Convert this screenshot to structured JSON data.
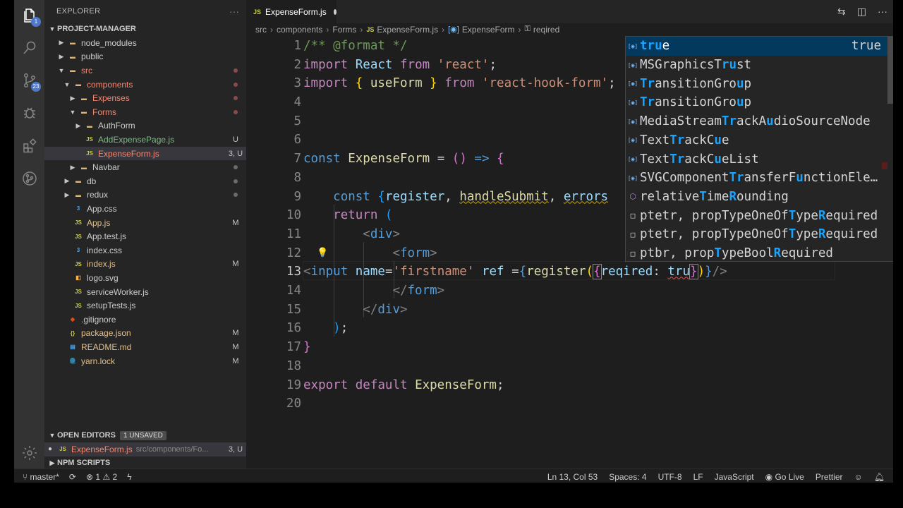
{
  "sidebar": {
    "title": "EXPLORER",
    "project": "PROJECT-MANAGER",
    "tree": [
      {
        "label": "node_modules",
        "kind": "folder",
        "depth": 1,
        "open": false,
        "deco": ""
      },
      {
        "label": "public",
        "kind": "folder",
        "depth": 1,
        "open": false,
        "deco": ""
      },
      {
        "label": "src",
        "kind": "folder",
        "depth": 1,
        "open": true,
        "deco": "dot",
        "color": "red"
      },
      {
        "label": "components",
        "kind": "folder",
        "depth": 2,
        "open": true,
        "deco": "dot",
        "color": "red"
      },
      {
        "label": "Expenses",
        "kind": "folder",
        "depth": 3,
        "open": false,
        "deco": "dot",
        "color": "red"
      },
      {
        "label": "Forms",
        "kind": "folder",
        "depth": 3,
        "open": true,
        "deco": "dot",
        "color": "red"
      },
      {
        "label": "AuthForm",
        "kind": "folder",
        "depth": 4,
        "open": false,
        "deco": ""
      },
      {
        "label": "AddExpensePage.js",
        "kind": "js",
        "depth": 4,
        "deco": "U",
        "color": "green"
      },
      {
        "label": "ExpenseForm.js",
        "kind": "js",
        "depth": 4,
        "deco": "3, U",
        "color": "red",
        "selected": true
      },
      {
        "label": "Navbar",
        "kind": "folder",
        "depth": 3,
        "open": false,
        "deco": "dot",
        "color": "gray"
      },
      {
        "label": "db",
        "kind": "folder",
        "depth": 2,
        "open": false,
        "deco": "dot",
        "color": "gray"
      },
      {
        "label": "redux",
        "kind": "folder",
        "depth": 2,
        "open": false,
        "deco": "dot",
        "color": "gray"
      },
      {
        "label": "App.css",
        "kind": "css",
        "depth": 2,
        "deco": ""
      },
      {
        "label": "App.js",
        "kind": "js",
        "depth": 2,
        "deco": "M",
        "color": "yellow"
      },
      {
        "label": "App.test.js",
        "kind": "js",
        "depth": 2,
        "deco": ""
      },
      {
        "label": "index.css",
        "kind": "css",
        "depth": 2,
        "deco": ""
      },
      {
        "label": "index.js",
        "kind": "js",
        "depth": 2,
        "deco": "M",
        "color": "yellow"
      },
      {
        "label": "logo.svg",
        "kind": "svg",
        "depth": 2,
        "deco": ""
      },
      {
        "label": "serviceWorker.js",
        "kind": "js",
        "depth": 2,
        "deco": ""
      },
      {
        "label": "setupTests.js",
        "kind": "js",
        "depth": 2,
        "deco": ""
      },
      {
        "label": ".gitignore",
        "kind": "git",
        "depth": 1,
        "deco": ""
      },
      {
        "label": "package.json",
        "kind": "json",
        "depth": 1,
        "deco": "M",
        "color": "yellow"
      },
      {
        "label": "README.md",
        "kind": "md",
        "depth": 1,
        "deco": "M",
        "color": "yellow"
      },
      {
        "label": "yarn.lock",
        "kind": "yarn",
        "depth": 1,
        "deco": "M",
        "color": "yellow"
      }
    ],
    "open_editors": {
      "title": "OPEN EDITORS",
      "badge": "1 UNSAVED",
      "file": "ExpenseForm.js",
      "path": "src/components/Fo...",
      "deco": "3, U"
    },
    "npm_scripts": "NPM SCRIPTS",
    "activity_badges": {
      "explorer": "1",
      "scm": "23"
    }
  },
  "tab": {
    "label": "ExpenseForm.js",
    "icon": "JS"
  },
  "breadcrumb": [
    "src",
    "components",
    "Forms",
    "ExpenseForm.js",
    "ExpenseForm",
    "reqired"
  ],
  "editor": {
    "line_numbers": [
      "1",
      "2",
      "3",
      "4",
      "5",
      "6",
      "7",
      "8",
      "9",
      "10",
      "11",
      "12",
      "13",
      "14",
      "15",
      "16",
      "17",
      "18",
      "19",
      "20"
    ],
    "lines": {
      "l1": "/** @format */",
      "l2_kw": "import",
      "l2_var": "React",
      "l2_from": "from",
      "l2_str": "'react'",
      "l3_kw": "import",
      "l3_fn": "useForm",
      "l3_from": "from",
      "l3_str": "'react-hook-form'",
      "l7_kw": "const",
      "l7_fn": "ExpenseForm",
      "l9_kw": "const",
      "l9_reg": "register",
      "l9_hs": "handleSubmit",
      "l9_err": "errors",
      "l10_kw": "return",
      "l11_tag": "div",
      "l12_tag": "form",
      "l13_tag": "input",
      "l13_attr1": "name",
      "l13_str": "'firstname'",
      "l13_attr2": "ref",
      "l13_fn": "register",
      "l13_key": "reqired",
      "l13_val": "tru",
      "l14_tag": "form",
      "l15_tag": "div",
      "l19_kw1": "export",
      "l19_kw2": "default",
      "l19_fn": "ExpenseForm"
    }
  },
  "suggest": {
    "items": [
      {
        "pre": "",
        "hl": "tru",
        "post": "e",
        "icon": "var",
        "detail": "true"
      },
      {
        "pre": "MSGraphicsT",
        "hl": "ru",
        "post": "st",
        "icon": "var"
      },
      {
        "pre": "",
        "hl": "Tr",
        "post": "ansitionGro",
        "hl2": "u",
        "post2": "p",
        "icon": "var"
      },
      {
        "pre": "",
        "hl": "Tr",
        "post": "ansitionGro",
        "hl2": "u",
        "post2": "p",
        "icon": "var"
      },
      {
        "pre": "MediaStream",
        "hl": "Tr",
        "post": "ackA",
        "hl2": "u",
        "post2": "dioSourceNode",
        "icon": "var"
      },
      {
        "pre": "Text",
        "hl": "Tr",
        "post": "ackC",
        "hl2": "u",
        "post2": "e",
        "icon": "var"
      },
      {
        "pre": "Text",
        "hl": "Tr",
        "post": "ackC",
        "hl2": "u",
        "post2": "eList",
        "icon": "var"
      },
      {
        "pre": "SVGComponent",
        "hl": "Tr",
        "post": "ansferF",
        "hl2": "u",
        "post2": "nctionEle…",
        "icon": "var"
      },
      {
        "pre": "relative",
        "hl": "T",
        "post": "ime",
        "hl2": "R",
        "post2": "ounding",
        "icon": "prop"
      },
      {
        "pre": "ptetr, propTypeOneOf",
        "hl": "T",
        "post": "ype",
        "hl2": "R",
        "post2": "equired",
        "icon": "snip"
      },
      {
        "pre": "ptetr, propTypeOneOf",
        "hl": "T",
        "post": "ype",
        "hl2": "R",
        "post2": "equired",
        "icon": "snip"
      },
      {
        "pre": "ptbr, prop",
        "hl": "T",
        "post": "ypeBool",
        "hl2": "R",
        "post2": "equired",
        "icon": "snip"
      }
    ]
  },
  "status": {
    "branch": "master*",
    "errors": "1",
    "warnings": "2",
    "position": "Ln 13, Col 53",
    "spaces": "Spaces: 4",
    "encoding": "UTF-8",
    "eol": "LF",
    "language": "JavaScript",
    "golive": "Go Live",
    "prettier": "Prettier"
  },
  "colors": {
    "accent": "#4d78cc",
    "selection": "#04395e",
    "highlight": "#18a3ff"
  }
}
